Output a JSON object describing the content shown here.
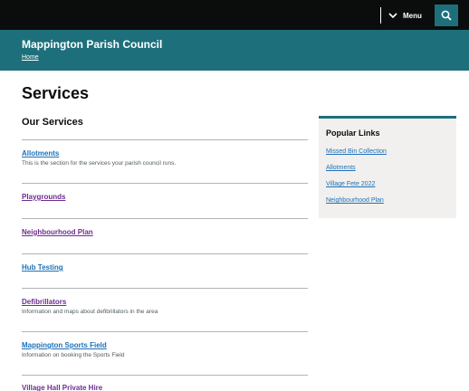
{
  "topbar": {
    "menu_label": "Menu",
    "menu_icon": "chevron-down-icon",
    "search_icon": "search-icon"
  },
  "header": {
    "site_title": "Mappington Parish Council",
    "breadcrumb_home": "Home"
  },
  "main": {
    "page_title": "Services",
    "section_title": "Our Services",
    "services": [
      {
        "title": "Allotments",
        "description": "This is the section for the services your parish council runs."
      },
      {
        "title": "Playgrounds",
        "description": ""
      },
      {
        "title": "Neighbourhood Plan",
        "description": ""
      },
      {
        "title": "Hub Testing",
        "description": ""
      },
      {
        "title": "Defibrillators",
        "description": "Information and maps about defibrillators in the area"
      },
      {
        "title": "Mappington Sports Field",
        "description": "Information on booking the Sports Field"
      },
      {
        "title": "Village Hall Private Hire",
        "description": ""
      }
    ]
  },
  "aside": {
    "title": "Popular Links",
    "links": [
      "Missed Bin Collection",
      "Allotments",
      "Village Fete 2022",
      "Neighbourhood Plan"
    ]
  },
  "colors": {
    "header_teal": "#1d707b",
    "topbar": "#0b0c0c",
    "link_blue": "#1d70b8",
    "link_visited": "#6f2c91",
    "aside_bg": "#f1f0ee"
  }
}
